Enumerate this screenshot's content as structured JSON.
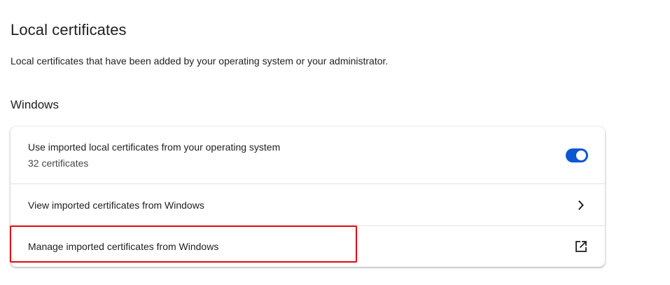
{
  "page": {
    "title": "Local certificates",
    "description": "Local certificates that have been added by your operating system or your administrator."
  },
  "section": {
    "title": "Windows"
  },
  "settings": {
    "use_imported": {
      "label": "Use imported local certificates from your operating system",
      "sublabel": "32 certificates",
      "enabled": true
    },
    "view_imported": {
      "label": "View imported certificates from Windows",
      "icon": "chevron-right-icon"
    },
    "manage_imported": {
      "label": "Manage imported certificates from Windows",
      "icon": "open-in-new-icon"
    }
  },
  "colors": {
    "accent": "#0b57d0",
    "highlight": "#e30613"
  }
}
